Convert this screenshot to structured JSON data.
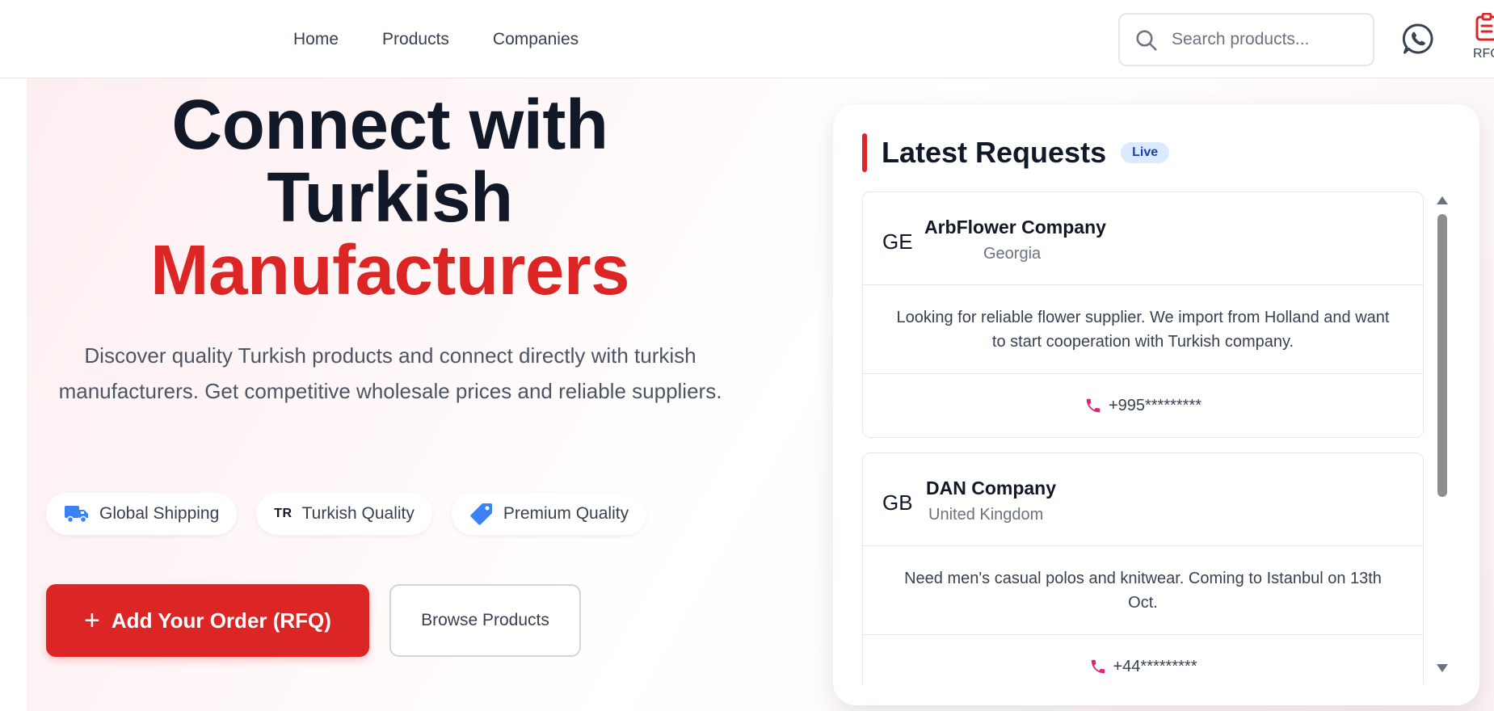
{
  "nav": {
    "items": [
      {
        "label": "Home"
      },
      {
        "label": "Products"
      },
      {
        "label": "Companies"
      }
    ]
  },
  "search": {
    "placeholder": "Search products..."
  },
  "header_actions": {
    "rfq_label": "RFQ"
  },
  "hero": {
    "title_line1": "Connect with",
    "title_line2": "Turkish",
    "title_accent": "Manufacturers",
    "description": "Discover quality Turkish products and connect directly with turkish manufacturers. Get competitive wholesale prices and reliable suppliers.",
    "badges": [
      {
        "label": "Global Shipping",
        "icon": "truck-icon"
      },
      {
        "label": "Turkish Quality",
        "code": "TR"
      },
      {
        "label": "Premium Quality",
        "icon": "tag-icon"
      }
    ],
    "primary_button": "Add Your Order (RFQ)",
    "secondary_button": "Browse Products"
  },
  "requests": {
    "title": "Latest Requests",
    "live_label": "Live",
    "items": [
      {
        "flag": "GE",
        "company": "ArbFlower Company",
        "country": "Georgia",
        "message": "Looking for reliable flower supplier. We import from Holland and want to start cooperation with Turkish company.",
        "phone": "+995*********"
      },
      {
        "flag": "GB",
        "company": "DAN Company",
        "country": "United Kingdom",
        "message": "Need men's casual polos and knitwear. Coming to Istanbul on 13th Oct.",
        "phone": "+44*********"
      }
    ]
  },
  "colors": {
    "accent": "#dc2626",
    "text_dark": "#111827",
    "text_muted": "#6b7280",
    "live_bg": "#dbeafe",
    "live_text": "#1e40af",
    "badge_icon": "#3b82f6",
    "phone_icon": "#db2777"
  }
}
